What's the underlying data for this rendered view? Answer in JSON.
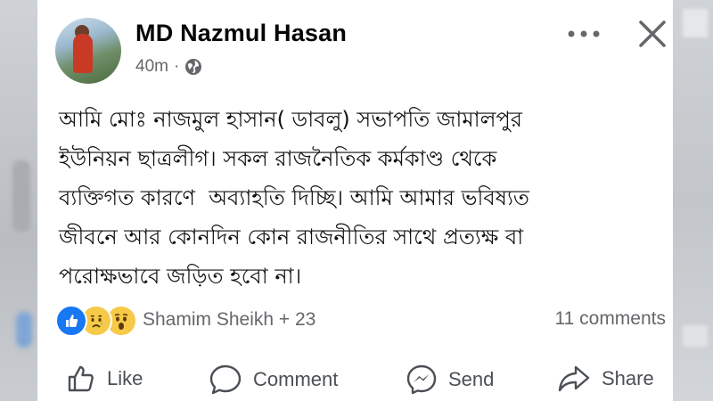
{
  "post": {
    "author": "MD Nazmul Hasan",
    "time": "40m",
    "separator": "·",
    "privacy_icon": "globe-icon",
    "body": "আমি মোঃ নাজমুল হাসান( ডাবলু) সভাপতি জামালপুর\nইউনিয়ন ছাত্রলীগ। সকল রাজনৈতিক কর্মকাণ্ড থেকে\nব্যক্তিগত কারণে  অব্যাহতি দিচ্ছি। আমি আমার ভবিষ্যত\nজীবনে আর কোনদিন কোন রাজনীতির সাথে প্রত্যক্ষ বা\nপরোক্ষভাবে জড়িত হবো না।"
  },
  "reactions": {
    "icons": [
      "like-icon",
      "sad-icon",
      "wow-icon"
    ],
    "summary": "Shamim Sheikh + 23",
    "comments": "11 comments"
  },
  "actions": {
    "like": "Like",
    "comment": "Comment",
    "send": "Send",
    "share": "Share"
  },
  "colors": {
    "like_blue": "#1877f2",
    "text_secondary": "#65676b",
    "reaction_yellow": "#f7c948"
  }
}
